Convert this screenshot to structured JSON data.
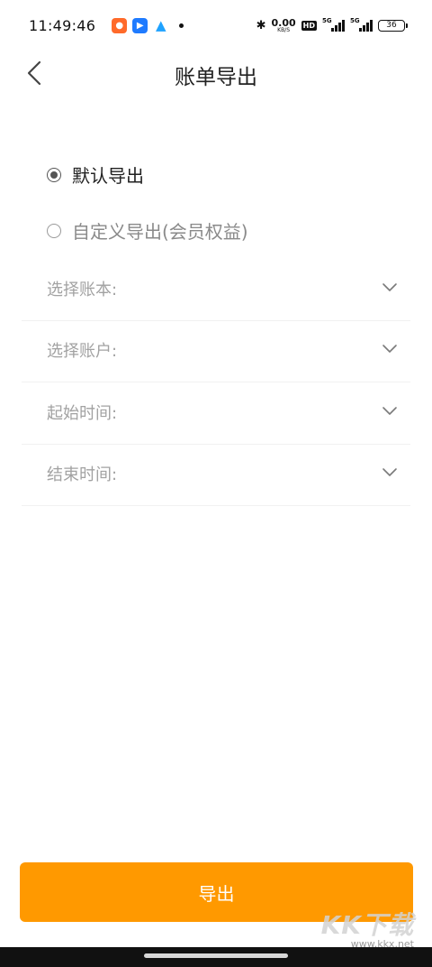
{
  "status_bar": {
    "time": "11:49:46",
    "net_speed_value": "0.00",
    "net_speed_unit": "KB/S",
    "hd": "HD",
    "signal1_tag": "5G",
    "signal2_tag": "5G",
    "battery": "36",
    "icons": [
      "app-orange-icon",
      "app-blue-icon",
      "qq-icon",
      "bluetooth-icon"
    ]
  },
  "header": {
    "title": "账单导出"
  },
  "options": {
    "default_label": "默认导出",
    "custom_label": "自定义导出(会员权益)",
    "selected": "default"
  },
  "selects": [
    {
      "label": "选择账本:"
    },
    {
      "label": "选择账户:"
    },
    {
      "label": "起始时间:"
    },
    {
      "label": "结束时间:"
    }
  ],
  "export_button": {
    "label": "导出"
  },
  "watermark": {
    "big": "KK下载",
    "small": "www.kkx.net"
  },
  "colors": {
    "accent": "#ff9900",
    "muted_text": "#a2a2a2"
  }
}
